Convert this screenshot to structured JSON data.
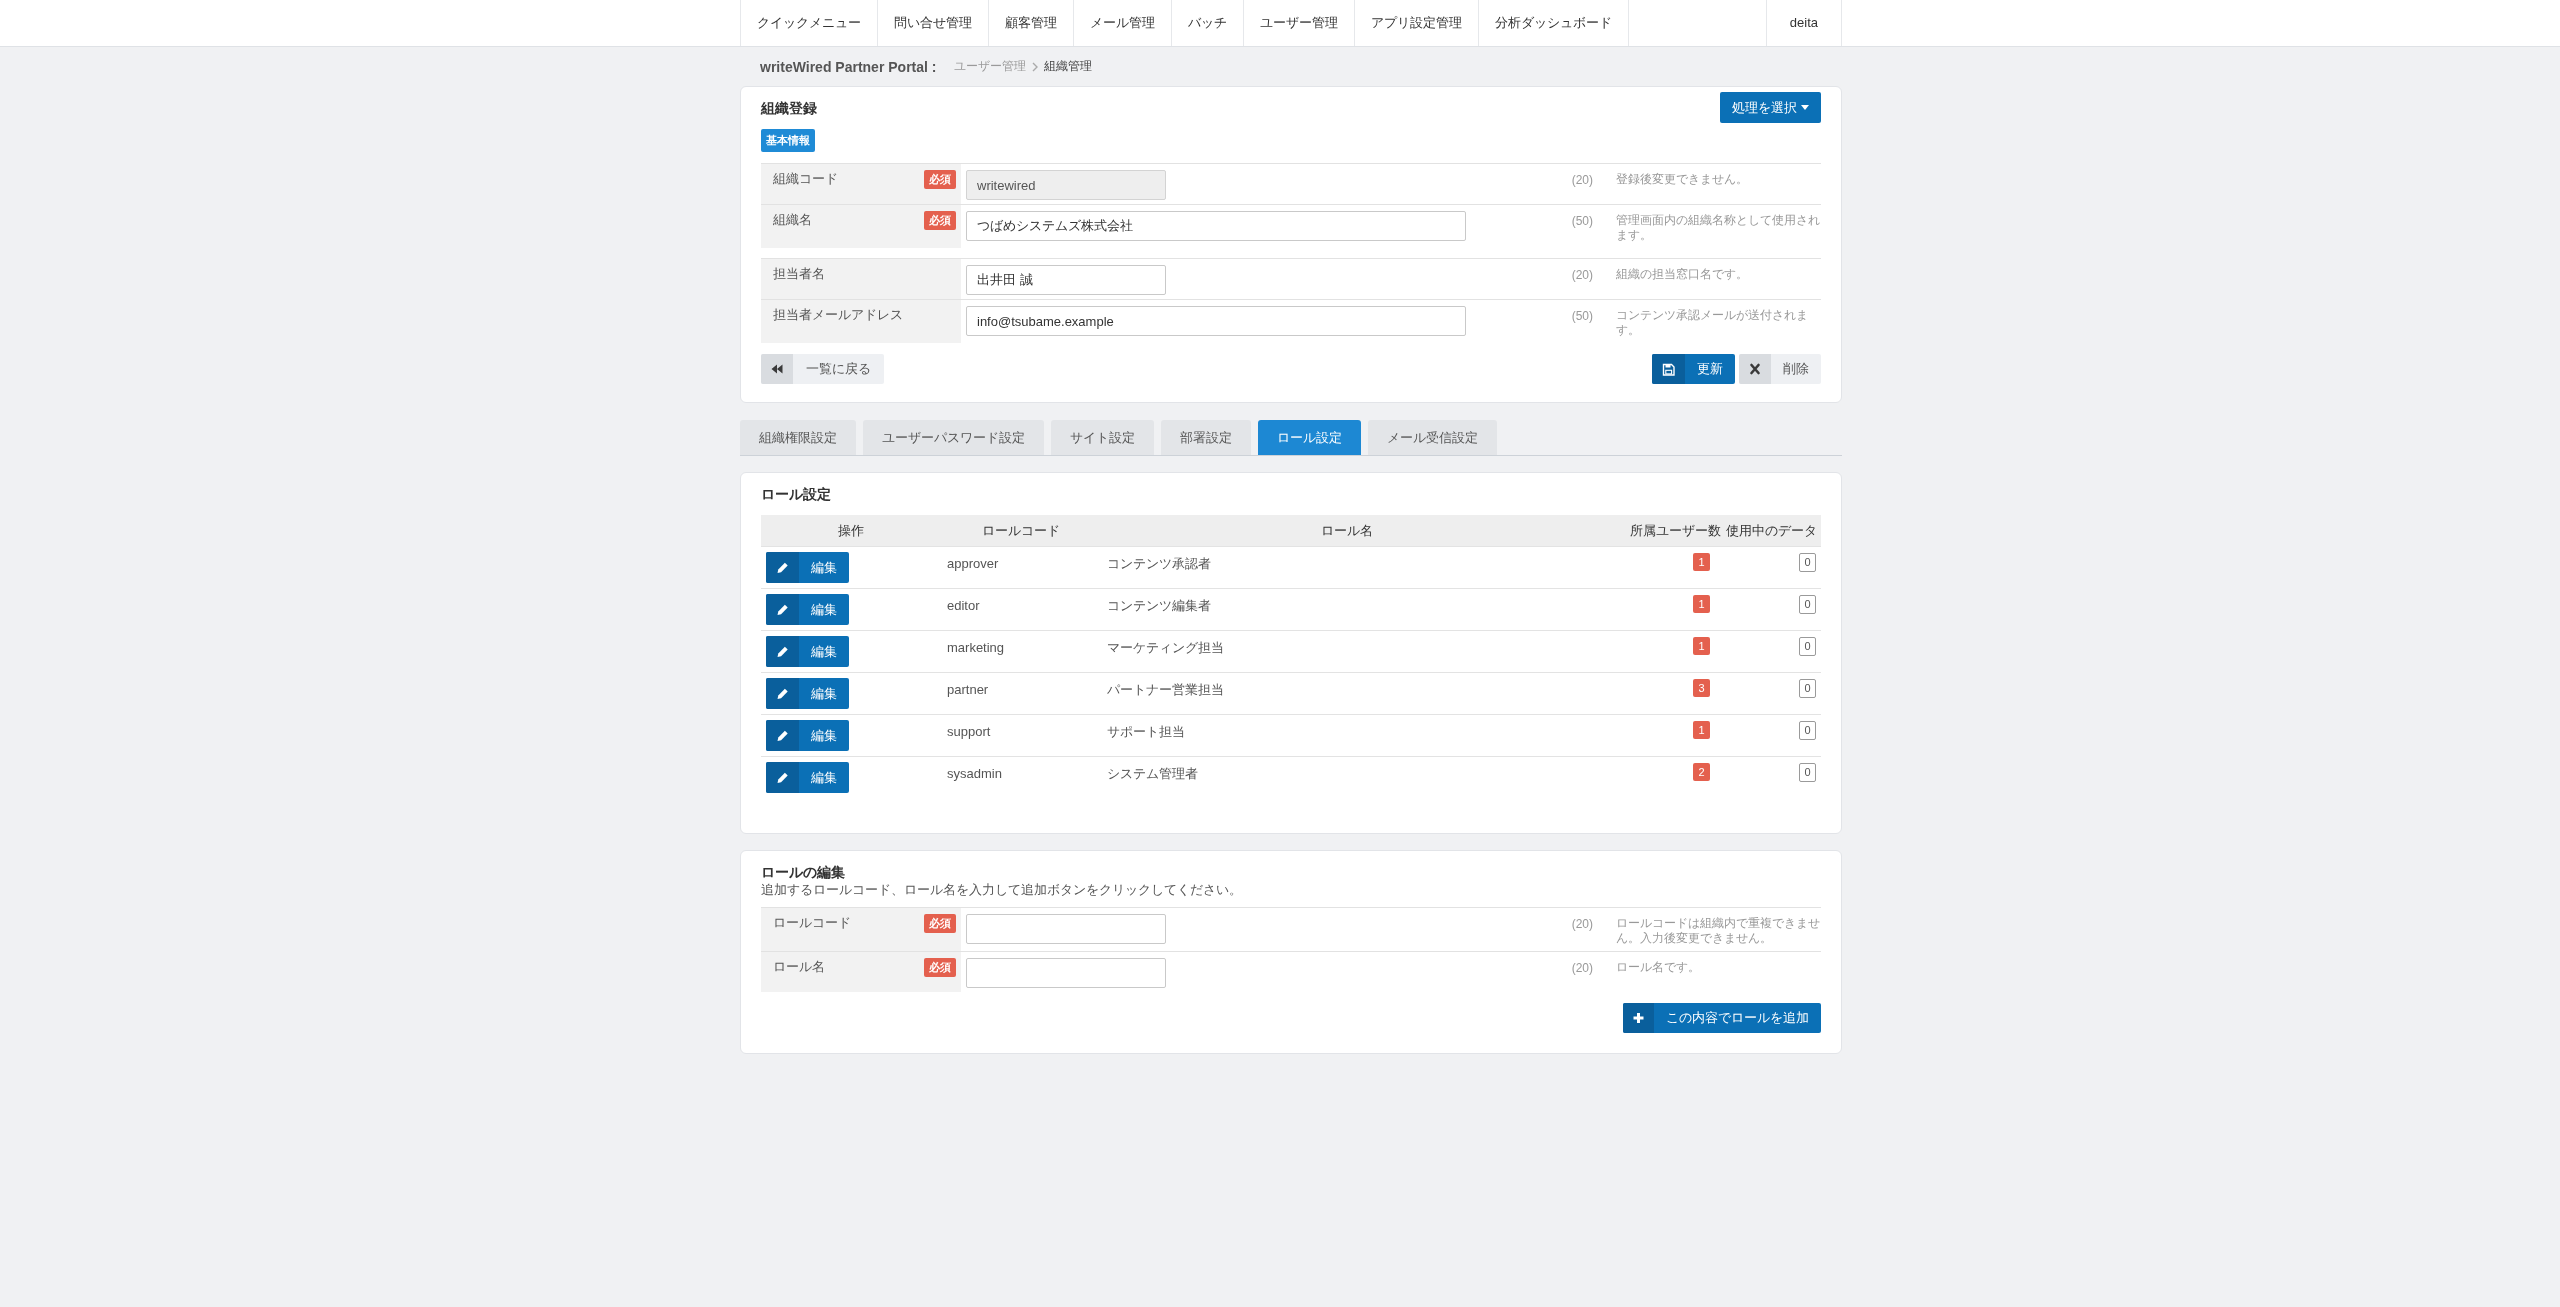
{
  "nav": {
    "items": [
      "クイックメニュー",
      "問い合せ管理",
      "顧客管理",
      "メール管理",
      "バッチ",
      "ユーザー管理",
      "アプリ設定管理",
      "分析ダッシュボード"
    ],
    "user": "deita"
  },
  "breadcrumb": {
    "title": "writeWired Partner Portal :",
    "items": [
      {
        "label": "ユーザー管理",
        "current": false
      },
      {
        "label": "組織管理",
        "current": true
      }
    ]
  },
  "org_form": {
    "title": "組織登録",
    "menu_button": "処理を選択",
    "section_label": "基本情報",
    "groups": [
      {
        "rows": [
          {
            "label": "組織コード",
            "required": "必須",
            "kind": "short",
            "value": "writewired",
            "disabled": true,
            "limit": "(20)",
            "note": "登録後変更できません。"
          },
          {
            "label": "組織名",
            "required": "必須",
            "kind": "long",
            "value": "つばめシステムズ株式会社",
            "disabled": false,
            "limit": "(50)",
            "note": "管理画面内の組織名称として使用されます。"
          }
        ]
      },
      {
        "rows": [
          {
            "label": "担当者名",
            "kind": "short",
            "value": "出井田 誠",
            "disabled": false,
            "limit": "(20)",
            "note": "組織の担当窓口名です。"
          },
          {
            "label": "担当者メールアドレス",
            "kind": "long",
            "value": "info@tsubame.example",
            "disabled": false,
            "limit": "(50)",
            "note": "コンテンツ承認メールが送付されます。"
          }
        ]
      }
    ],
    "buttons": [
      {
        "label": "一覧に戻る",
        "kind": "back"
      },
      {
        "label": "更新",
        "kind": "save"
      },
      {
        "label": "削除",
        "kind": "delete"
      }
    ]
  },
  "tabs": [
    {
      "label": "組織権限設定",
      "selected": false
    },
    {
      "label": "ユーザーパスワード設定",
      "selected": false
    },
    {
      "label": "サイト設定",
      "selected": false
    },
    {
      "label": "部署設定",
      "selected": false
    },
    {
      "label": "ロール設定",
      "selected": true
    },
    {
      "label": "メール受信設定",
      "selected": false
    }
  ],
  "roles": {
    "title": "ロール設定",
    "columns": [
      "操作",
      "ロールコード",
      "ロール名",
      "所属ユーザー数",
      "使用中のデータ"
    ],
    "rows": [
      {
        "action": "編集",
        "code": "approver",
        "name": "コンテンツ承認者",
        "users": "1",
        "data_count": "0"
      },
      {
        "action": "編集",
        "code": "editor",
        "name": "コンテンツ編集者",
        "users": "1",
        "data_count": "0"
      },
      {
        "action": "編集",
        "code": "marketing",
        "name": "マーケティング担当",
        "users": "1",
        "data_count": "0"
      },
      {
        "action": "編集",
        "code": "partner",
        "name": "パートナー営業担当",
        "users": "3",
        "data_count": "0"
      },
      {
        "action": "編集",
        "code": "support",
        "name": "サポート担当",
        "users": "1",
        "data_count": "0"
      },
      {
        "action": "編集",
        "code": "sysadmin",
        "name": "システム管理者",
        "users": "2",
        "data_count": "0"
      }
    ]
  },
  "role_edit": {
    "title": "ロールの編集",
    "description": "追加するロールコード、ロール名を入力して追加ボタンをクリックしてください。",
    "rows": [
      {
        "label": "ロールコード",
        "required": "必須",
        "kind": "short",
        "disabled": false,
        "limit": "(20)",
        "note": "ロールコードは組織内で重複できません。入力後変更できません。"
      },
      {
        "label": "ロール名",
        "required": "必須",
        "kind": "short",
        "disabled": false,
        "limit": "(20)",
        "note": "ロール名です。"
      }
    ],
    "add_button": "この内容でロールを追加"
  }
}
